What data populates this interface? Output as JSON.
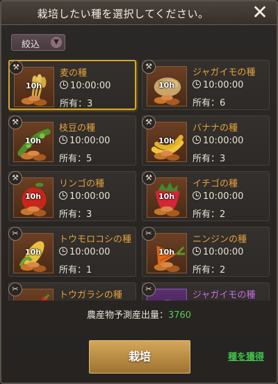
{
  "dialog": {
    "title": "栽培したい種を選択してください。",
    "close_icon": "close-icon"
  },
  "filter": {
    "label": "絞込",
    "icon": "chevron-down-icon"
  },
  "hours_label": "10h",
  "seeds": [
    {
      "name": "麦の種",
      "time": "10:00:00",
      "owned": "所有：3",
      "tool": "sickle",
      "crop": "wheat",
      "selected": true
    },
    {
      "name": "ジャガイモの種",
      "time": "10:00:00",
      "owned": "所有：6",
      "tool": "sickle",
      "crop": "potato"
    },
    {
      "name": "枝豆の種",
      "time": "10:00:00",
      "owned": "所有：5",
      "tool": "sickle",
      "crop": "edamame"
    },
    {
      "name": "バナナの種",
      "time": "10:00:00",
      "owned": "所有：3",
      "tool": "sickle",
      "crop": "banana"
    },
    {
      "name": "リンゴの種",
      "time": "10:00:00",
      "owned": "所有：3",
      "tool": "sickle",
      "crop": "apple"
    },
    {
      "name": "イチゴの種",
      "time": "10:00:00",
      "owned": "所有：2",
      "tool": "sickle",
      "crop": "strawberry"
    },
    {
      "name": "トウモロコシの種",
      "time": "10:00:00",
      "owned": "所有：1",
      "tool": "scissors",
      "crop": "corn"
    },
    {
      "name": "ニンジンの種",
      "time": "10:00:00",
      "owned": "所有：2",
      "tool": "scissors",
      "crop": "carrot"
    },
    {
      "name": "トウガラシの種",
      "time": "",
      "owned": "",
      "tool": "scissors",
      "crop": "pepper"
    },
    {
      "name": "ジャガイモの種",
      "time": "",
      "owned": "",
      "tool": "scissors",
      "crop": "potato",
      "rare": true
    }
  ],
  "yield": {
    "label": "農産物予測産出量：",
    "value": "3760"
  },
  "grow_button": "栽培",
  "get_seeds_link": "種を獲得",
  "colors": {
    "accent_gold": "#d8a72a",
    "seed_name": "#e6a23a",
    "rare_name": "#c76ce6",
    "green": "#57c95a"
  }
}
